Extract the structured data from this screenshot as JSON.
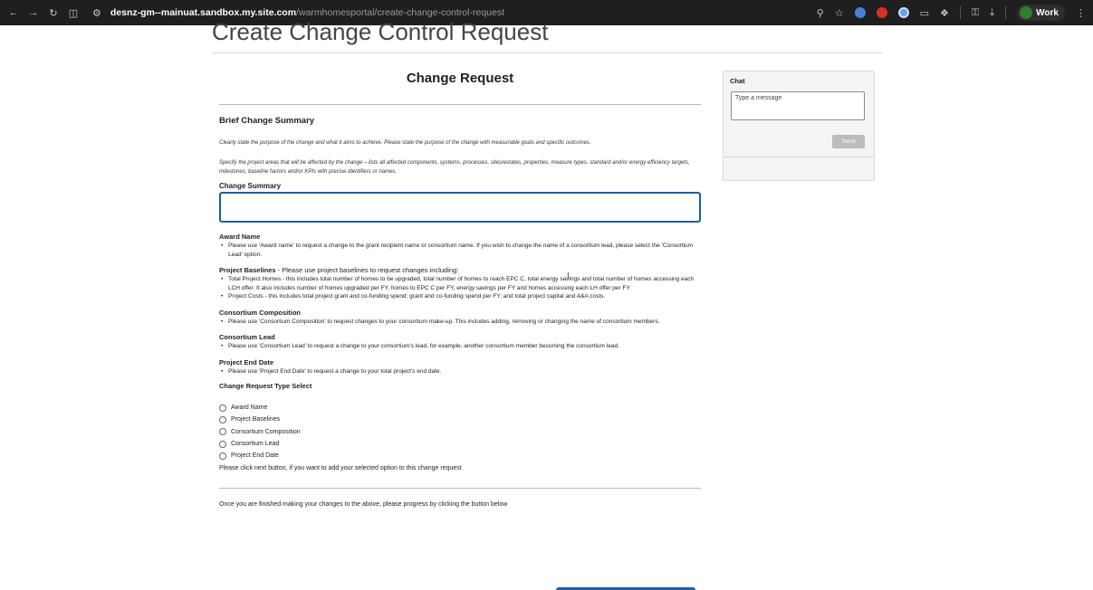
{
  "browser": {
    "url_host": "desnz-gm--mainuat.sandbox.my.site.com",
    "url_path": "/warmhomesportal/create-change-control-request",
    "profile_label": "Work"
  },
  "page": {
    "title": "Create Change Control Request"
  },
  "form": {
    "title": "Change Request",
    "brief_heading": "Brief Change Summary",
    "brief_p1": "Clearly state the purpose of the change and what it aims to achieve. Please state the purpose of the change with measurable goals and specific outcomes.",
    "brief_p2": "Specify the project areas that will be affected by the change – lists all affected components, systems, processes, sites/estates, properties, measure types, standard and/or energy efficiency targets, milestones, baseline factors and/or KPIs with precise identifiers or names.",
    "change_summary_label": "Change Summary",
    "change_summary_value": "",
    "award_name": {
      "heading": "Award Name",
      "bullets": [
        "Please use 'Award name' to request a change to the grant recipient name or consortium name. If you wish to change the name of a consortium lead, please select the 'Consortium Lead' option."
      ]
    },
    "project_baselines": {
      "heading": "Project Baselines",
      "intro": " - Please use project baselines to request changes including:",
      "bullets": [
        "Total Project Homes - this includes total number of homes to be upgraded, total number of homes to reach EPC C, total energy savings and total number of homes accessing each LCH offer. It also includes number of homes upgraded per FY, homes to EPC C per FY, energy savings per FY and homes accessing each LH offer per FY.",
        "Project Costs - this includes total project grant and co-funding spend; grant and co-funding spend per FY; and total project capital and A&A costs."
      ]
    },
    "consortium_composition": {
      "heading": "Consortium Composition",
      "bullets": [
        "Please use 'Consortium Composition' to request changes to your consortium make-up. This includes adding, removing or changing the name of consortium members."
      ]
    },
    "consortium_lead": {
      "heading": "Consortium Lead",
      "bullets": [
        "Please use 'Consortium Lead' to request a change to your consortium's lead, for example, another consortium member becoming the consortium lead."
      ]
    },
    "project_end_date": {
      "heading": "Project End Date",
      "bullets": [
        "Please use 'Project End Date' to request a change to your total project's end date."
      ]
    },
    "type_select_heading": "Change Request Type Select",
    "type_options": [
      "Award Name",
      "Project Baselines",
      "Consortium Composition",
      "Consortium Lead",
      "Project End Date"
    ],
    "next_note": "Please click next button, if you want to add your selected option to this change request",
    "progress_note": "Once you are finished making your changes to the above, please progress by clicking the button below"
  },
  "chat": {
    "title": "Chat",
    "placeholder": "Type a message",
    "send_label": "Send"
  },
  "colors": {
    "accent": "#1b5fa8",
    "chrome_bg": "#1f1f1f",
    "send_disabled": "#bcbcbc"
  }
}
